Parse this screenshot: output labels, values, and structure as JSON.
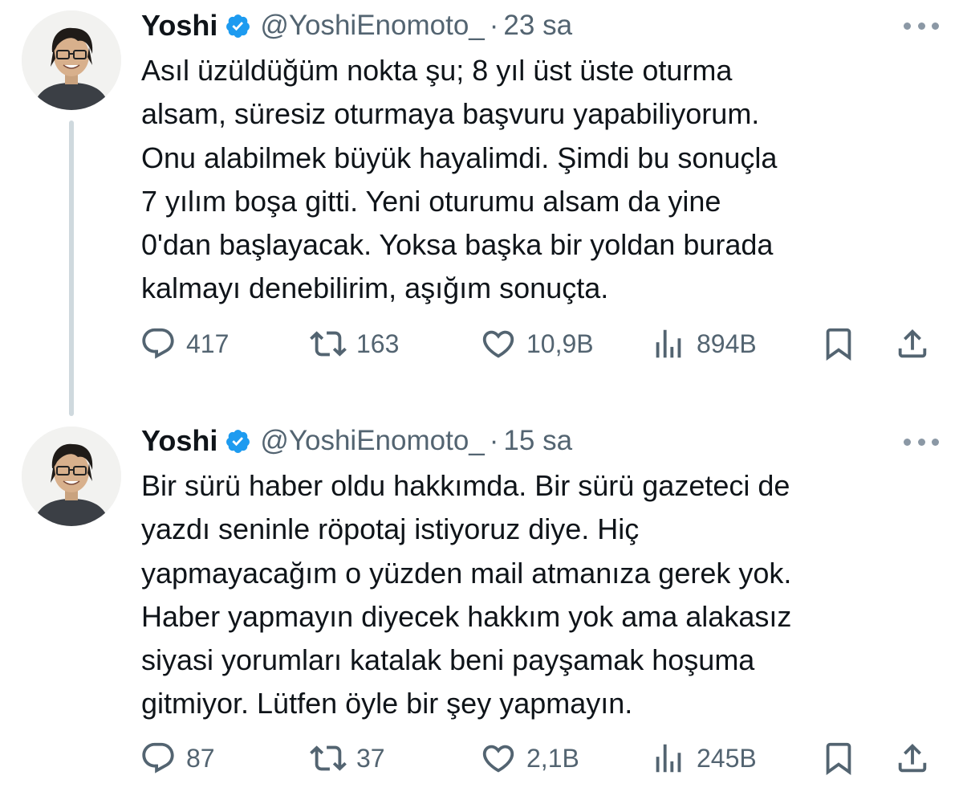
{
  "colors": {
    "text": "#0f1419",
    "secondary": "#536471",
    "verified": "#1d9bf0",
    "thread_line": "#cfd9de"
  },
  "tweets": [
    {
      "author": {
        "display_name": "Yoshi",
        "handle": "@YoshiEnomoto_",
        "verified": true,
        "avatar_icon": "person-with-glasses-avatar"
      },
      "separator": "·",
      "time": "23 sa",
      "text": "Asıl üzüldüğüm nokta şu; 8 yıl üst üste oturma\nalsam, süresiz oturmaya başvuru yapabiliyorum.\nOnu alabilmek büyük hayalimdi. Şimdi bu sonuçla\n7 yılım boşa gitti. Yeni oturumu alsam da yine\n0'dan başlayacak. Yoksa başka bir yoldan burada\nkalmayı denebilirim, aşığım sonuçta.",
      "stats": {
        "replies": "417",
        "retweets": "163",
        "likes": "10,9B",
        "views": "894B"
      }
    },
    {
      "author": {
        "display_name": "Yoshi",
        "handle": "@YoshiEnomoto_",
        "verified": true,
        "avatar_icon": "person-with-glasses-avatar"
      },
      "separator": "·",
      "time": "15 sa",
      "text": "Bir sürü haber oldu hakkımda. Bir sürü gazeteci de\nyazdı seninle röpotaj istiyoruz diye. Hiç\nyapmayacağım o yüzden mail atmanıza gerek yok.\nHaber yapmayın diyecek hakkım yok ama alakasız\nsiyasi yorumları katalak beni payşamak hoşuma\ngitmiyor. Lütfen öyle bir şey yapmayın.",
      "stats": {
        "replies": "87",
        "retweets": "37",
        "likes": "2,1B",
        "views": "245B"
      }
    }
  ]
}
